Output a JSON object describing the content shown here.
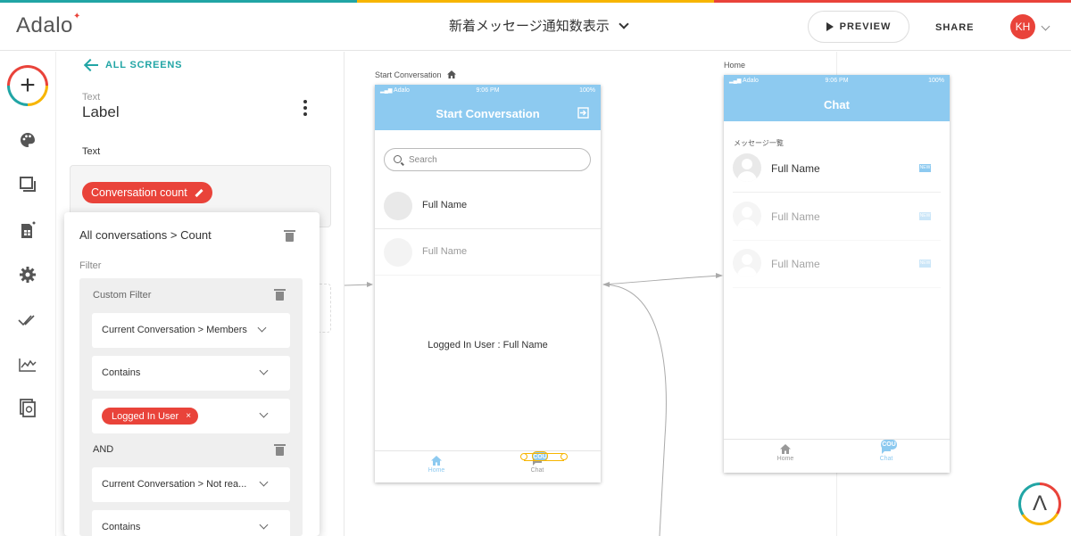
{
  "colors": {
    "teal": "#21a5a5",
    "yellow": "#f7b500",
    "red": "#e9433a",
    "header_blue": "#8dcaf0"
  },
  "topbar": {
    "logo": "Adalo",
    "app_title": "新着メッセージ通知数表示",
    "preview_label": "PREVIEW",
    "share_label": "SHARE",
    "user_initials": "KH"
  },
  "leftnav": {
    "icons": [
      "add-icon",
      "palette-icon",
      "screens-icon",
      "database-icon",
      "settings-icon",
      "checkmarks-icon",
      "analytics-icon",
      "publish-icon"
    ]
  },
  "properties": {
    "back_label": "ALL SCREENS",
    "component_type": "Text",
    "component_name": "Label",
    "text_section_label": "Text",
    "text_chip": "Conversation count"
  },
  "filter_popover": {
    "title": "All conversations > Count",
    "filter_label": "Filter",
    "custom_filter_label": "Custom Filter",
    "field1": "Current Conversation > Members",
    "operator1": "Contains",
    "value1_chip": "Logged In User",
    "and_label": "AND",
    "field2": "Current Conversation > Not rea...",
    "operator2": "Contains"
  },
  "screens": {
    "start": {
      "label": "Start Conversation",
      "status_carrier": "Adalo",
      "status_time": "9:06 PM",
      "status_battery": "100%",
      "title": "Start Conversation",
      "search_placeholder": "Search",
      "rows": [
        "Full Name",
        "Full Name"
      ],
      "logged_text": "Logged In User : Full Name",
      "tabs": [
        "Home",
        "Chat"
      ],
      "badge": "COU"
    },
    "home": {
      "label": "Home",
      "status_carrier": "Adalo",
      "status_time": "9:06 PM",
      "status_battery": "100%",
      "title": "Chat",
      "section_label": "メッセージ一覧",
      "rows": [
        "Full Name",
        "Full Name",
        "Full Name"
      ],
      "new_badge": "NEW",
      "tabs": [
        "Home",
        "Chat"
      ],
      "badge": "COU"
    }
  }
}
